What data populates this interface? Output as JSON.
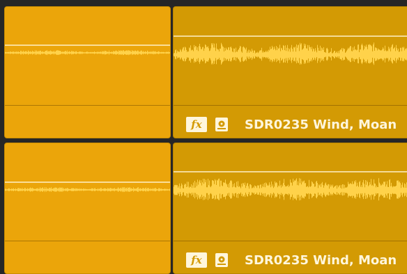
{
  "tracks": [
    {
      "left_clip": {},
      "right_clip": {
        "name": "SDR0235 Wind, Moan",
        "fx_label": "fx",
        "icon": "clip-attributes-icon"
      }
    },
    {
      "left_clip": {},
      "right_clip": {
        "name": "SDR0235 Wind, Moan",
        "fx_label": "fx",
        "icon": "clip-attributes-icon"
      }
    }
  ],
  "colors": {
    "clip_bright": "#eba50a",
    "clip_selected": "#d39a04",
    "waveform": "#ffd24a",
    "label": "#fff6dc",
    "background": "#262626"
  }
}
